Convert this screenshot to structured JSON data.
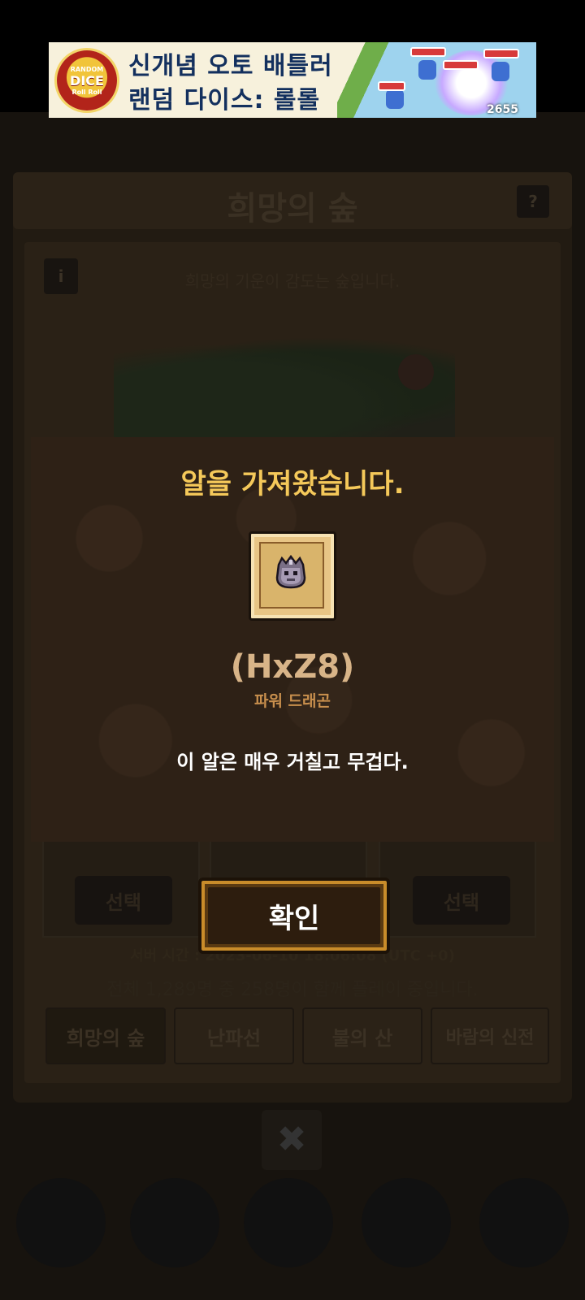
{
  "ad": {
    "logo_top": "RANDOM",
    "logo_big": "DICE",
    "logo_bottom": "Roll Roll",
    "line1": "신개념 오토 배틀러",
    "line2": "랜덤 다이스: 롤롤",
    "damage_number": "2655"
  },
  "background": {
    "header_title": "희망의 숲",
    "help_label": "?",
    "info_label": "i",
    "map_description": "희망의 기운이 감도는 숲입니다.",
    "select_left": "선택",
    "select_right": "선택",
    "server_time": "서버 시간 : 2023-06-10 18:06:08 (UTC +0)",
    "user_count": "전체 1,289명 중 258명이 함께 플레이 중입니다.",
    "tabs": [
      "희망의 숲",
      "난파선",
      "불의 산",
      "바람의 신전"
    ],
    "close_label": "✖"
  },
  "modal": {
    "title": "알을 가져왔습니다.",
    "egg_name": "(HxZ8)",
    "egg_type": "파워 드래곤",
    "description": "이 알은 매우 거칠고 무겁다.",
    "confirm_label": "확인",
    "colors": {
      "title": "#f5c95a",
      "name": "#d8b488",
      "type": "#c88f4d",
      "panel": "#2e2116"
    }
  }
}
